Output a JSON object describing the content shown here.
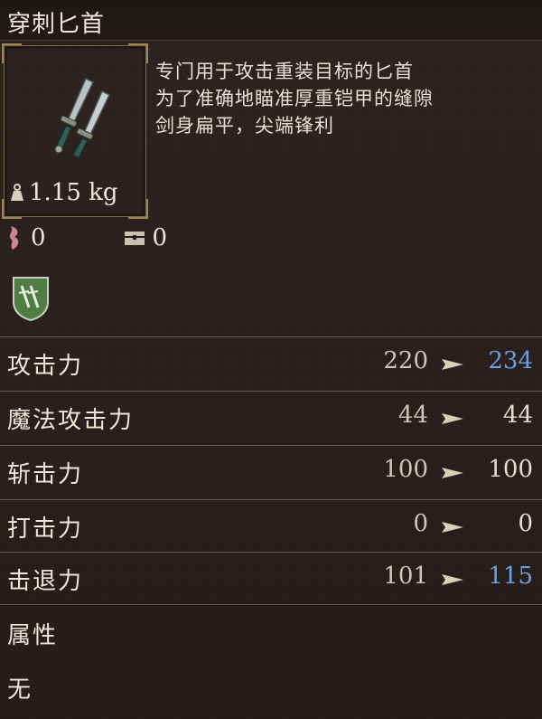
{
  "item": {
    "title": "穿刺匕首",
    "weight": "1.15 kg",
    "description": [
      "专门用于攻击重装目标的匕首",
      "为了准确地瞄准厚重铠甲的缝隙",
      "剑身扁平，尖端锋利"
    ]
  },
  "resources": {
    "stamina_cost": "0",
    "storage_value": "0"
  },
  "stats": [
    {
      "label": "攻击力",
      "base": "220",
      "new": "234",
      "color": "#6a9fe0"
    },
    {
      "label": "魔法攻击力",
      "base": "44",
      "new": "44",
      "color": "#e6ddd0"
    },
    {
      "label": "斩击力",
      "base": "100",
      "new": "100",
      "color": "#e6ddd0"
    },
    {
      "label": "打击力",
      "base": "0",
      "new": "0",
      "color": "#e6ddd0"
    },
    {
      "label": "击退力",
      "base": "101",
      "new": "115",
      "color": "#6a9fe0"
    }
  ],
  "attributes": {
    "label": "属性",
    "value": "无"
  },
  "icons": {
    "weapon": "dagger-icon",
    "weight": "weight-icon",
    "stamina": "stamina-icon",
    "storage": "chest-icon",
    "class": "shield-icon",
    "arrow": "arrow-right-icon"
  }
}
